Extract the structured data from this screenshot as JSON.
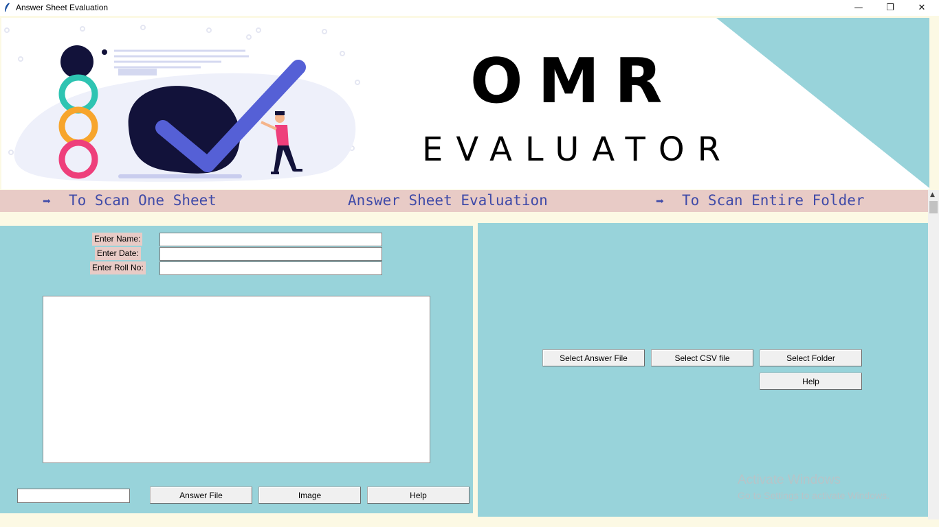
{
  "window": {
    "title": "Answer Sheet Evaluation",
    "controls": {
      "minimize": "—",
      "maximize": "❐",
      "close": "✕"
    }
  },
  "banner": {
    "line1": "OMR",
    "line2": "EVALUATOR",
    "accent_color": "#98d3da"
  },
  "strip": {
    "left_arrow": "➡",
    "left_label": "To Scan One Sheet",
    "center_label": "Answer Sheet Evaluation",
    "right_arrow": "➡",
    "right_label": "To Scan Entire Folder",
    "text_color": "#3f4aa8",
    "background": "#e8cbc6"
  },
  "single_sheet": {
    "name_label": "Enter Name:",
    "date_label": "Enter Date:",
    "roll_label": "Enter Roll No:",
    "name_value": "",
    "date_value": "",
    "roll_value": "",
    "output_text": "",
    "path_value": "",
    "answer_file_button": "Answer File",
    "image_button": "Image",
    "help_button": "Help"
  },
  "folder_scan": {
    "select_answer_button": "Select Answer File",
    "select_csv_button": "Select CSV file",
    "select_folder_button": "Select Folder",
    "help_button": "Help"
  },
  "watermark": {
    "title": "Activate Windows",
    "subtitle": "Go to Settings to activate Windows."
  },
  "colors": {
    "panel": "#98d3da",
    "label_bg": "#e8cbc6",
    "page_bg": "#fcf9e4"
  }
}
